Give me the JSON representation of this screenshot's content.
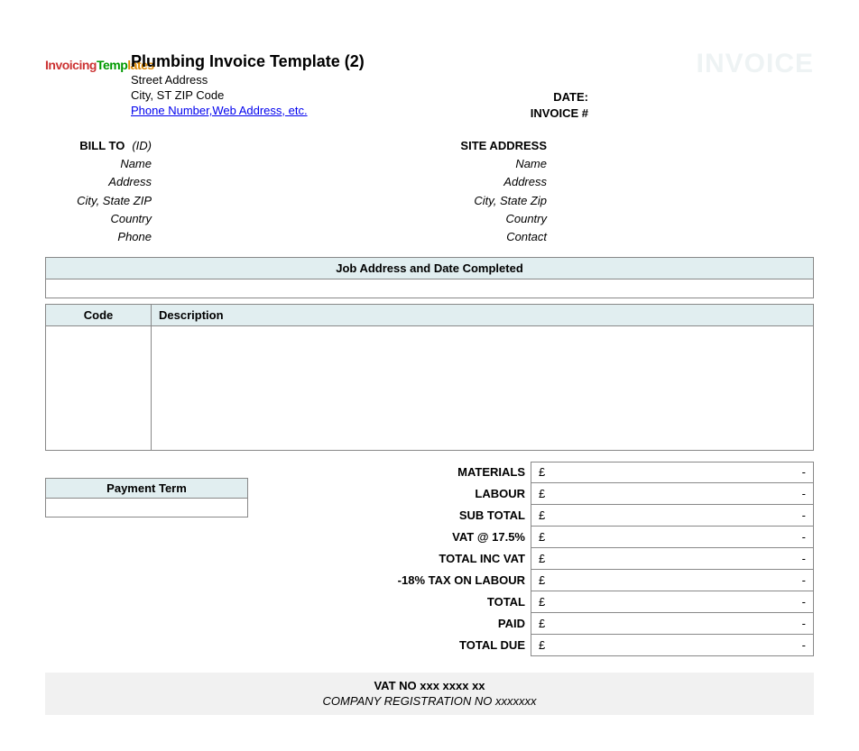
{
  "logo": {
    "part1": "Invoicing",
    "part2": "Temp",
    "part3": "lates"
  },
  "watermark": "INVOICE",
  "company": {
    "name": "Plumbing Invoice Template (2)",
    "street": "Street Address",
    "city_line": "City, ST  ZIP Code",
    "link": "Phone Number,Web Address, etc."
  },
  "meta": {
    "date_label": "DATE:",
    "invoice_no_label": "INVOICE #"
  },
  "billto": {
    "title": "BILL TO",
    "id": "(ID)",
    "name": "Name",
    "address": "Address",
    "city": "City, State ZIP",
    "country": "Country",
    "phone": "Phone"
  },
  "site": {
    "title": "SITE ADDRESS",
    "name": "Name",
    "address": "Address",
    "city": "City, State Zip",
    "country": "Country",
    "contact": "Contact"
  },
  "job_section": "Job Address and Date Completed",
  "table": {
    "code_header": "Code",
    "desc_header": "Description"
  },
  "payment": {
    "header": "Payment Term"
  },
  "currency": "£",
  "dash": "-",
  "totals": [
    {
      "label": "MATERIALS"
    },
    {
      "label": "LABOUR"
    },
    {
      "label": "SUB TOTAL"
    },
    {
      "label": "VAT @ 17.5%"
    },
    {
      "label": "TOTAL INC VAT"
    },
    {
      "label": "-18% TAX ON LABOUR"
    },
    {
      "label": "TOTAL"
    },
    {
      "label": "PAID"
    },
    {
      "label": "TOTAL DUE"
    }
  ],
  "footer": {
    "vat": "VAT NO  xxx xxxx xx",
    "reg": "COMPANY REGISTRATION NO xxxxxxx"
  }
}
